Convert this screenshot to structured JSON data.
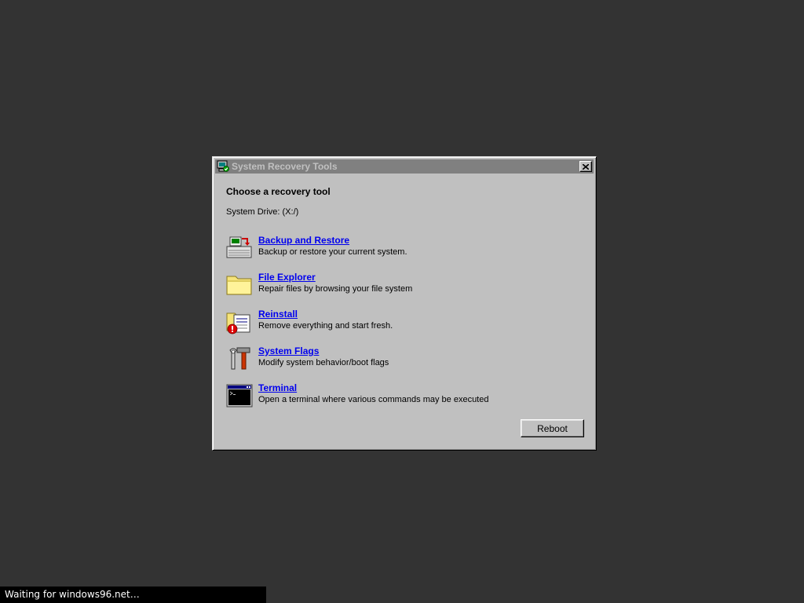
{
  "window": {
    "title": "System Recovery Tools",
    "title_icon": "recovery-computer-icon",
    "close_icon": "close-icon",
    "heading": "Choose a recovery tool",
    "system_drive": "System Drive: (X:/)"
  },
  "tools": [
    {
      "label": "Backup and Restore",
      "description": "Backup or restore your current system.",
      "icon": "backup-drive-icon"
    },
    {
      "label": "File Explorer",
      "description": "Repair files by browsing your file system",
      "icon": "folder-icon"
    },
    {
      "label": "Reinstall",
      "description": "Remove everything and start fresh.",
      "icon": "reinstall-icon"
    },
    {
      "label": "System Flags",
      "description": "Modify system behavior/boot flags",
      "icon": "tools-icon"
    },
    {
      "label": "Terminal",
      "description": "Open a terminal where various commands may be executed",
      "icon": "terminal-icon"
    }
  ],
  "buttons": {
    "reboot": "Reboot"
  },
  "status": {
    "text": "Waiting for windows96.net…"
  },
  "colors": {
    "desktop": "#333333",
    "window_face": "#c0c0c0",
    "titlebar_inactive": "#808080",
    "link": "#0000ee"
  }
}
